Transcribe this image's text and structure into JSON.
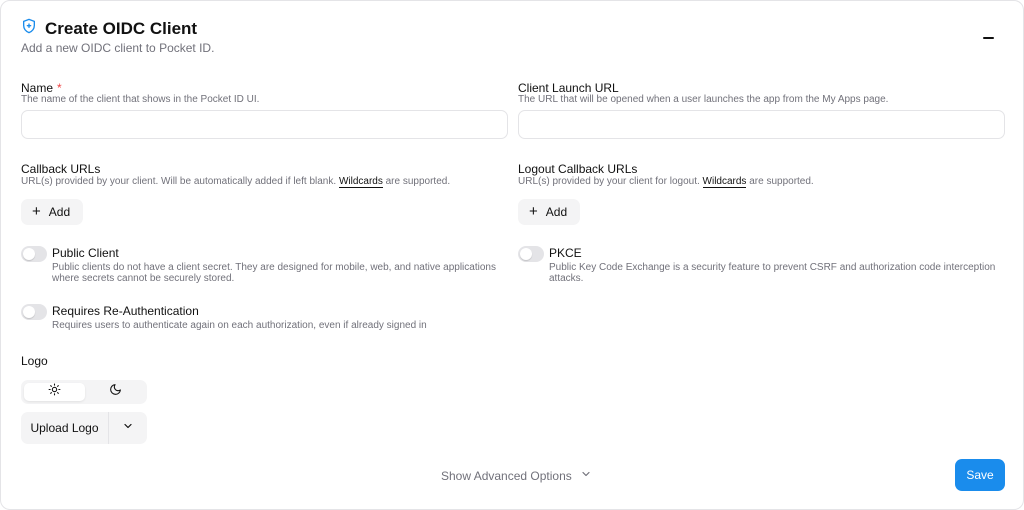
{
  "header": {
    "title": "Create OIDC Client",
    "subtitle": "Add a new OIDC client to Pocket ID."
  },
  "name_field": {
    "label": "Name",
    "required_mark": "*",
    "description": "The name of the client that shows in the Pocket ID UI.",
    "value": "",
    "placeholder": ""
  },
  "launch_url_field": {
    "label": "Client Launch URL",
    "description": "The URL that will be opened when a user launches the app from the My Apps page.",
    "value": "",
    "placeholder": ""
  },
  "callback_urls": {
    "label": "Callback URLs",
    "description_pre": "URL(s) provided by your client. Will be automatically added if left blank.",
    "wildcards_link": "Wildcards",
    "description_post": "are supported.",
    "add_label": "Add"
  },
  "logout_callback_urls": {
    "label": "Logout Callback URLs",
    "description_pre": "URL(s) provided by your client for logout.",
    "wildcards_link": "Wildcards",
    "description_post": "are supported.",
    "add_label": "Add"
  },
  "public_client": {
    "title": "Public Client",
    "description_line1": "Public clients do not have a client secret. They are designed for mobile, web, and native applications",
    "description_line2": "where secrets cannot be securely stored.",
    "enabled": false
  },
  "pkce": {
    "title": "PKCE",
    "description_line1": "Public Key Code Exchange is a security feature to prevent CSRF and authorization code interception",
    "description_line2": "attacks.",
    "enabled": false
  },
  "reauth": {
    "title": "Requires Re-Authentication",
    "description": "Requires users to authenticate again on each authorization, even if already signed in",
    "enabled": false
  },
  "logo": {
    "label": "Logo",
    "theme_options": [
      "light-sun-icon",
      "dark-moon-icon"
    ],
    "active_theme": "light",
    "upload_label": "Upload Logo"
  },
  "footer": {
    "advanced_label": "Show Advanced Options",
    "save_label": "Save"
  },
  "colors": {
    "accent": "#1a8cec",
    "required": "#ef4444",
    "muted_text": "#71717a",
    "header_icon": "#1a8cec"
  },
  "icons": {
    "header": "shield-plus-icon",
    "minimize": "minus-icon",
    "add": "plus-icon",
    "upload_menu": "chevron-down-icon",
    "advanced": "chevron-down-icon"
  }
}
